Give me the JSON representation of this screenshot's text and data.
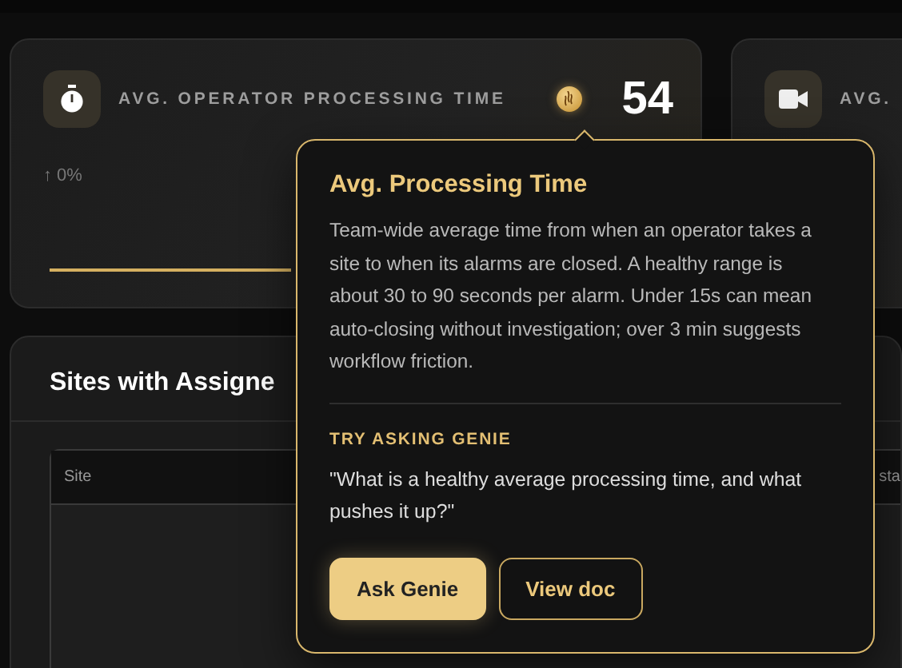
{
  "metrics": [
    {
      "kind": "timer",
      "label": "AVG. OPERATOR PROCESSING TIME",
      "value": "54",
      "trend": "↑ 0%"
    },
    {
      "kind": "camera",
      "label": "AVG."
    }
  ],
  "sites_panel": {
    "title": "Sites with Assigne",
    "columns": [
      "Site",
      "sta"
    ]
  },
  "popover": {
    "title": "Avg. Processing Time",
    "body": "Team-wide average time from when an operator takes a site to when its alarms are closed. A healthy range is about 30 to 90 seconds per alarm. Under 15s can mean auto-closing without investigation; over 3 min suggests workflow friction.",
    "section_label": "TRY ASKING GENIE",
    "prompt": "\"What is a healthy average processing time, and what pushes it up?\"",
    "buttons": [
      {
        "label": "Ask Genie",
        "kind": "primary"
      },
      {
        "label": "View doc",
        "kind": "secondary"
      }
    ]
  }
}
